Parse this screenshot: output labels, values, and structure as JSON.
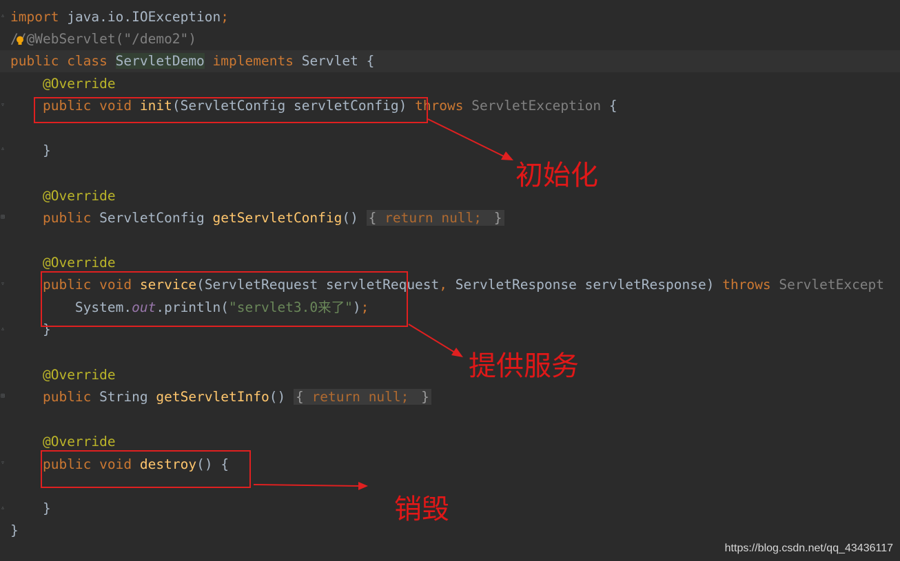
{
  "code": {
    "import_kw": "import",
    "import_path": "java.io.IOException",
    "semicolon": ";",
    "comment_prefix": "/",
    "comment_rest": "/@WebServlet(\"/demo2\")",
    "public": "public",
    "class_kw": "class",
    "class_name": "ServletDemo",
    "implements_kw": "implements",
    "interface_name": "Servlet",
    "open_brace": "{",
    "close_brace": "}",
    "override": "@Override",
    "void": "void",
    "init_name": "init",
    "init_params": "(ServletConfig servletConfig)",
    "throws": "throws",
    "servlet_exception": "ServletException",
    "servlet_exception_cut": "ServletExcept",
    "servlet_config_type": "ServletConfig",
    "get_config_name": "getServletConfig",
    "parens": "()",
    "fold_open": "{",
    "return_kw": "return",
    "null_kw": "null",
    "fold_close": "}",
    "service_name": "service",
    "service_param1": "(ServletRequest servletRequest",
    "comma": ",",
    "service_param2": " ServletResponse servletResponse)",
    "println_prefix": "System.",
    "println_out": "out",
    "println_call": ".println(",
    "println_str": "\"servlet3.0来了\"",
    "println_end": ")",
    "string_type": "String",
    "get_info_name": "getServletInfo",
    "destroy_name": "destroy"
  },
  "annotations": {
    "init_label": "初始化",
    "service_label": "提供服务",
    "destroy_label": "销毁"
  },
  "watermark": "https://blog.csdn.net/qq_43436117",
  "colors": {
    "background": "#2b2b2b",
    "keyword": "#cc7832",
    "annotation": "#bbb529",
    "function": "#ffc66d",
    "string": "#6a8759",
    "comment": "#808080",
    "markup_red": "#e02020"
  }
}
